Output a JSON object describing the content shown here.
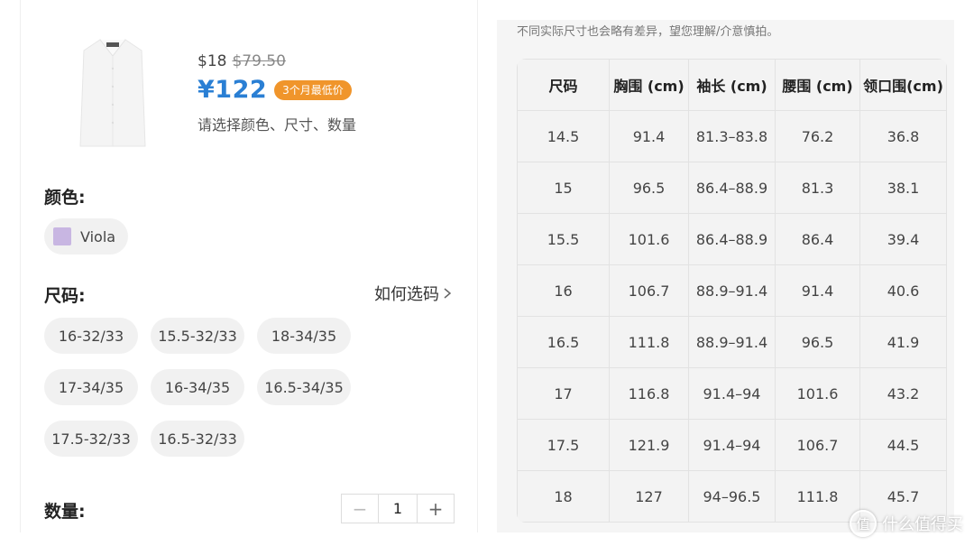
{
  "product": {
    "price_usd": "$18",
    "price_usd_original": "$79.50",
    "price_cny": "¥122",
    "price_badge": "3个月最低价",
    "select_hint": "请选择颜色、尺寸、数量"
  },
  "color": {
    "label": "颜色:",
    "options": [
      {
        "name": "Viola",
        "swatch": "#c8b6e2"
      }
    ]
  },
  "size": {
    "label": "尺码:",
    "guide_link": "如何选码",
    "options": [
      "16-32/33",
      "15.5-32/33",
      "18-34/35",
      "17-34/35",
      "16-34/35",
      "16.5-34/35",
      "17.5-32/33",
      "16.5-32/33"
    ]
  },
  "quantity": {
    "label": "数量:",
    "minus": "−",
    "value": "1",
    "plus": "+"
  },
  "size_chart": {
    "disclaimer": "不同实际尺寸也会略有差异，望您理解/介意慎拍。",
    "headers": [
      "尺码",
      "胸围 (cm)",
      "袖长 (cm)",
      "腰围 (cm)",
      "领口围(cm)"
    ],
    "rows": [
      [
        "14.5",
        "91.4",
        "81.3–83.8",
        "76.2",
        "36.8"
      ],
      [
        "15",
        "96.5",
        "86.4–88.9",
        "81.3",
        "38.1"
      ],
      [
        "15.5",
        "101.6",
        "86.4–88.9",
        "86.4",
        "39.4"
      ],
      [
        "16",
        "106.7",
        "88.9–91.4",
        "91.4",
        "40.6"
      ],
      [
        "16.5",
        "111.8",
        "88.9–91.4",
        "96.5",
        "41.9"
      ],
      [
        "17",
        "116.8",
        "91.4–94",
        "101.6",
        "43.2"
      ],
      [
        "17.5",
        "121.9",
        "91.4–94",
        "106.7",
        "44.5"
      ],
      [
        "18",
        "127",
        "94–96.5",
        "111.8",
        "45.7"
      ]
    ]
  },
  "watermark": {
    "logo": "值",
    "text": "什么值得买"
  },
  "colors": {
    "accent_price": "#2a7fd4",
    "badge": "#f0952b"
  }
}
